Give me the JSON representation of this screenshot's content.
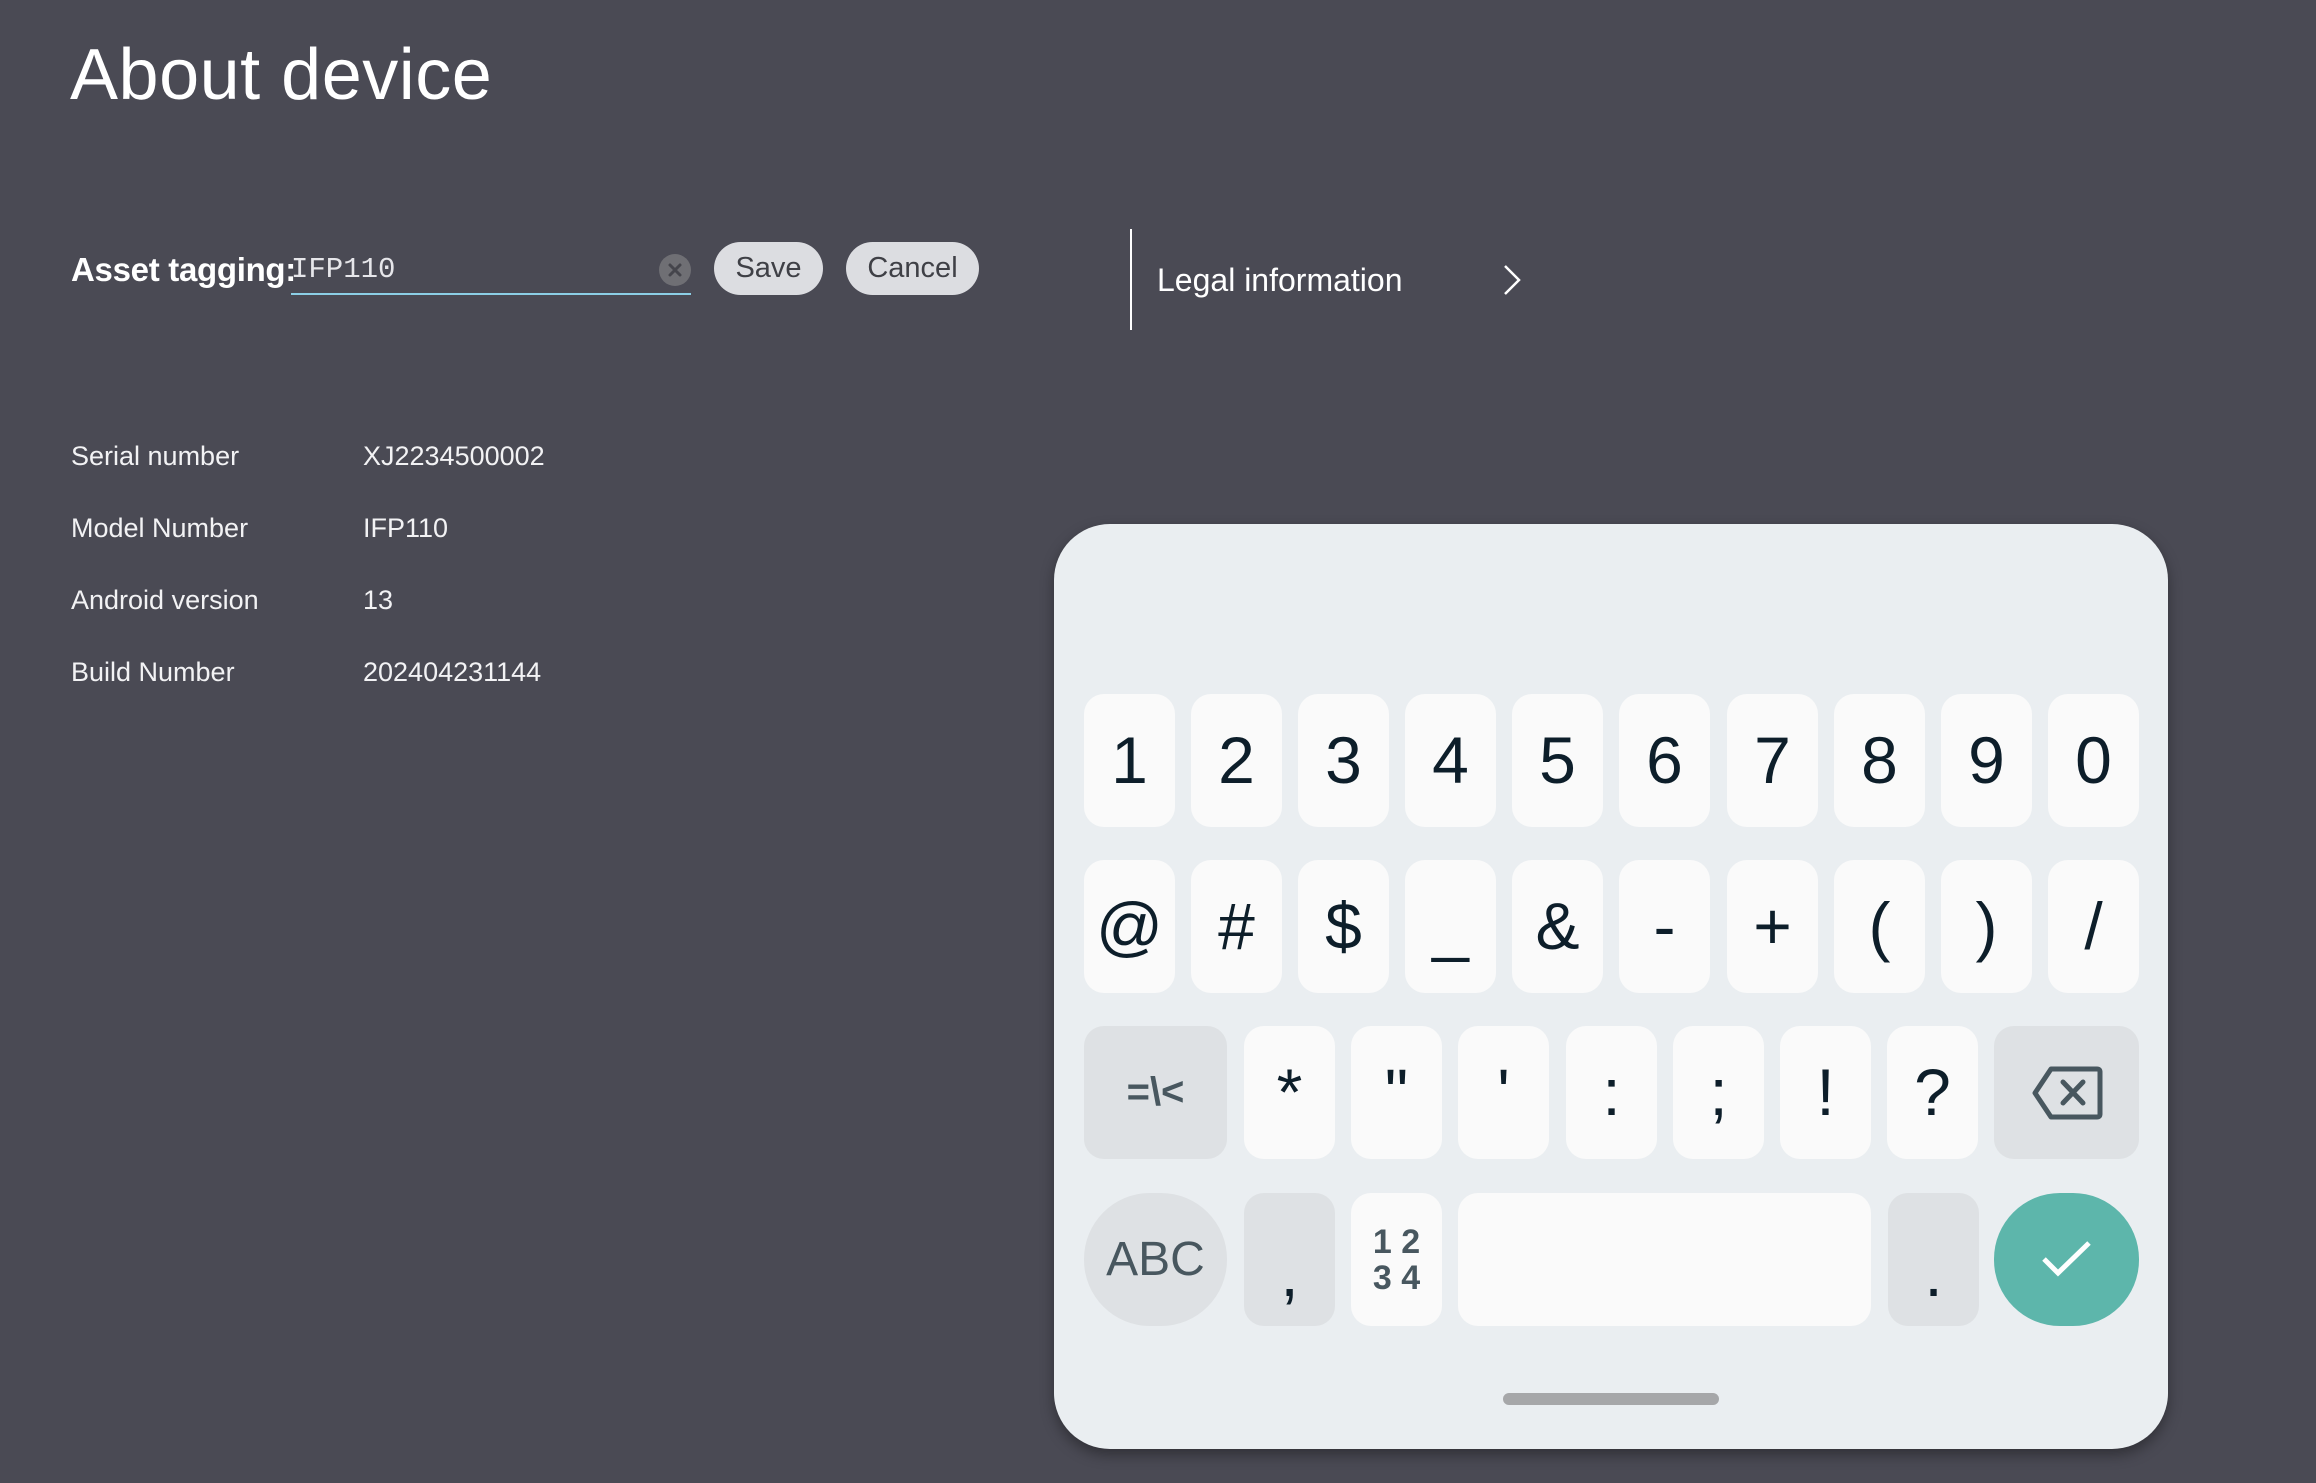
{
  "page": {
    "title": "About device",
    "background_color": "#4a4a54"
  },
  "asset_tagging": {
    "label": "Asset tagging:",
    "value": "IFP110",
    "placeholder": "",
    "clear_icon": "clear-circle-icon",
    "save_label": "Save",
    "cancel_label": "Cancel",
    "underline_color": "#8ccfe6"
  },
  "legal": {
    "label": "Legal information",
    "icon": "chevron-right-icon"
  },
  "info": [
    {
      "label": "Serial number",
      "value": "XJ2234500002"
    },
    {
      "label": "Model Number",
      "value": "IFP110"
    },
    {
      "label": "Android version",
      "value": "13"
    },
    {
      "label": "Build Number",
      "value": "202404231144"
    }
  ],
  "keyboard": {
    "background_color": "#eaeef1",
    "accent_color": "#5db6ab",
    "row1": [
      "1",
      "2",
      "3",
      "4",
      "5",
      "6",
      "7",
      "8",
      "9",
      "0"
    ],
    "row2": [
      "@",
      "#",
      "$",
      "_",
      "&",
      "-",
      "+",
      "(",
      ")",
      "/"
    ],
    "row3": {
      "more_symbols_label": "=\\<",
      "keys": [
        "*",
        "\"",
        "'",
        ":",
        ";",
        "!",
        "?"
      ],
      "backspace_icon": "backspace-icon"
    },
    "row4": {
      "abc_label": "ABC",
      "comma": ",",
      "numpad_label_line1": "1 2",
      "numpad_label_line2": "3 4",
      "space_label": "",
      "period": ".",
      "enter_icon": "checkmark-icon"
    }
  }
}
